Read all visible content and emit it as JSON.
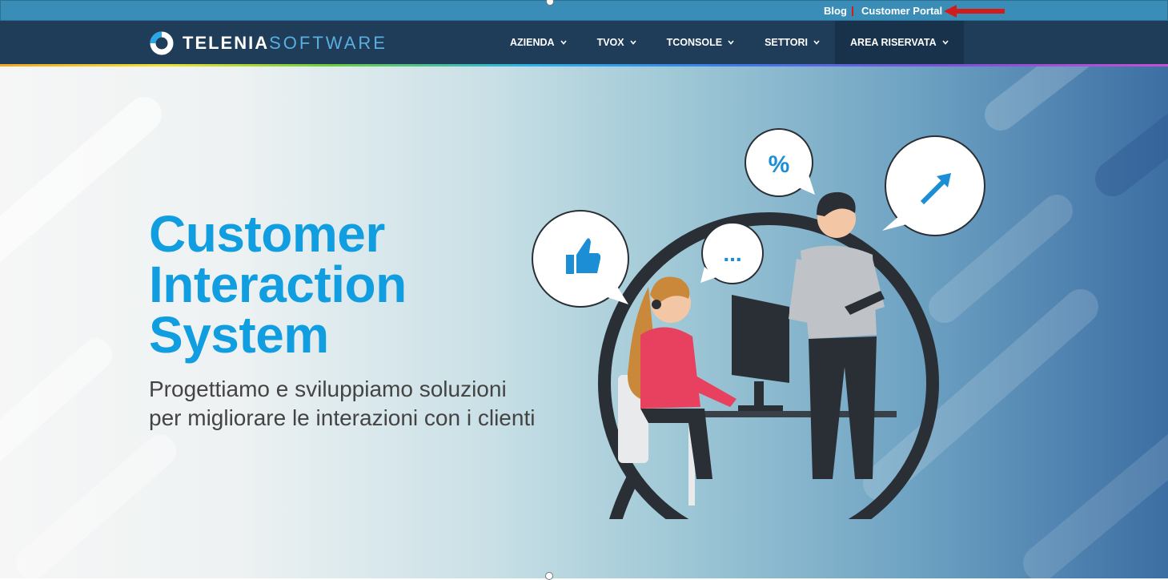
{
  "topbar": {
    "blog": "Blog",
    "customer_portal": "Customer Portal"
  },
  "logo": {
    "bold": "TELENIA",
    "light": "SOFTWARE"
  },
  "menu": [
    {
      "label": "AZIENDA"
    },
    {
      "label": "TVOX"
    },
    {
      "label": "TCONSOLE"
    },
    {
      "label": "SETTORI"
    },
    {
      "label": "AREA RISERVATA"
    }
  ],
  "hero": {
    "title_line1": "Customer",
    "title_line2": "Interaction",
    "title_line3": "System",
    "subtitle_line1": "Progettiamo e sviluppiamo soluzioni",
    "subtitle_line2": "per migliorare le interazioni con i clienti"
  },
  "illustration": {
    "percent": "%",
    "dots": "..."
  },
  "colors": {
    "topbar": "#3a8db6",
    "navbar": "#1f3d59",
    "accent": "#109ee0",
    "arrow": "#d21c1c"
  }
}
